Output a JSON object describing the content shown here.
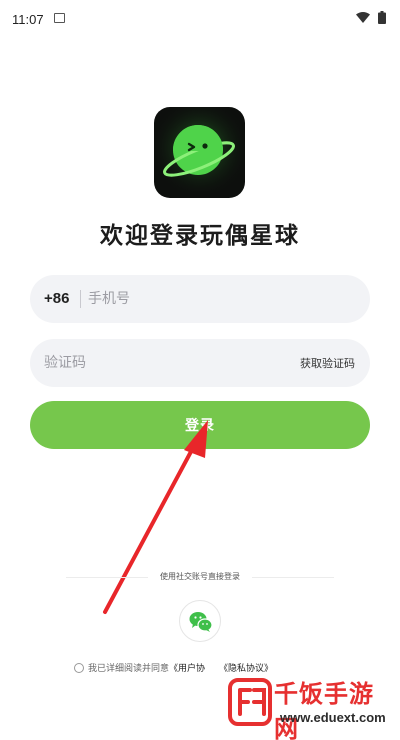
{
  "status_bar": {
    "time": "11:07"
  },
  "header": {
    "title": "欢迎登录玩偶星球"
  },
  "form": {
    "country_code": "+86",
    "phone_placeholder": "手机号",
    "code_placeholder": "验证码",
    "get_code_label": "获取验证码",
    "login_label": "登录"
  },
  "social": {
    "divider_text": "使用社交账号直接登录",
    "icon": "wechat-icon"
  },
  "agreement": {
    "prefix": "我已详细阅读并同意",
    "user_agreement": "《用户协",
    "privacy_policy": "《隐私协议》"
  },
  "watermark": {
    "name": "千饭手游网",
    "url": "www.eduext.com"
  },
  "colors": {
    "accent": "#76c74c",
    "watermark": "#e63030",
    "arrow": "#e8262a"
  }
}
